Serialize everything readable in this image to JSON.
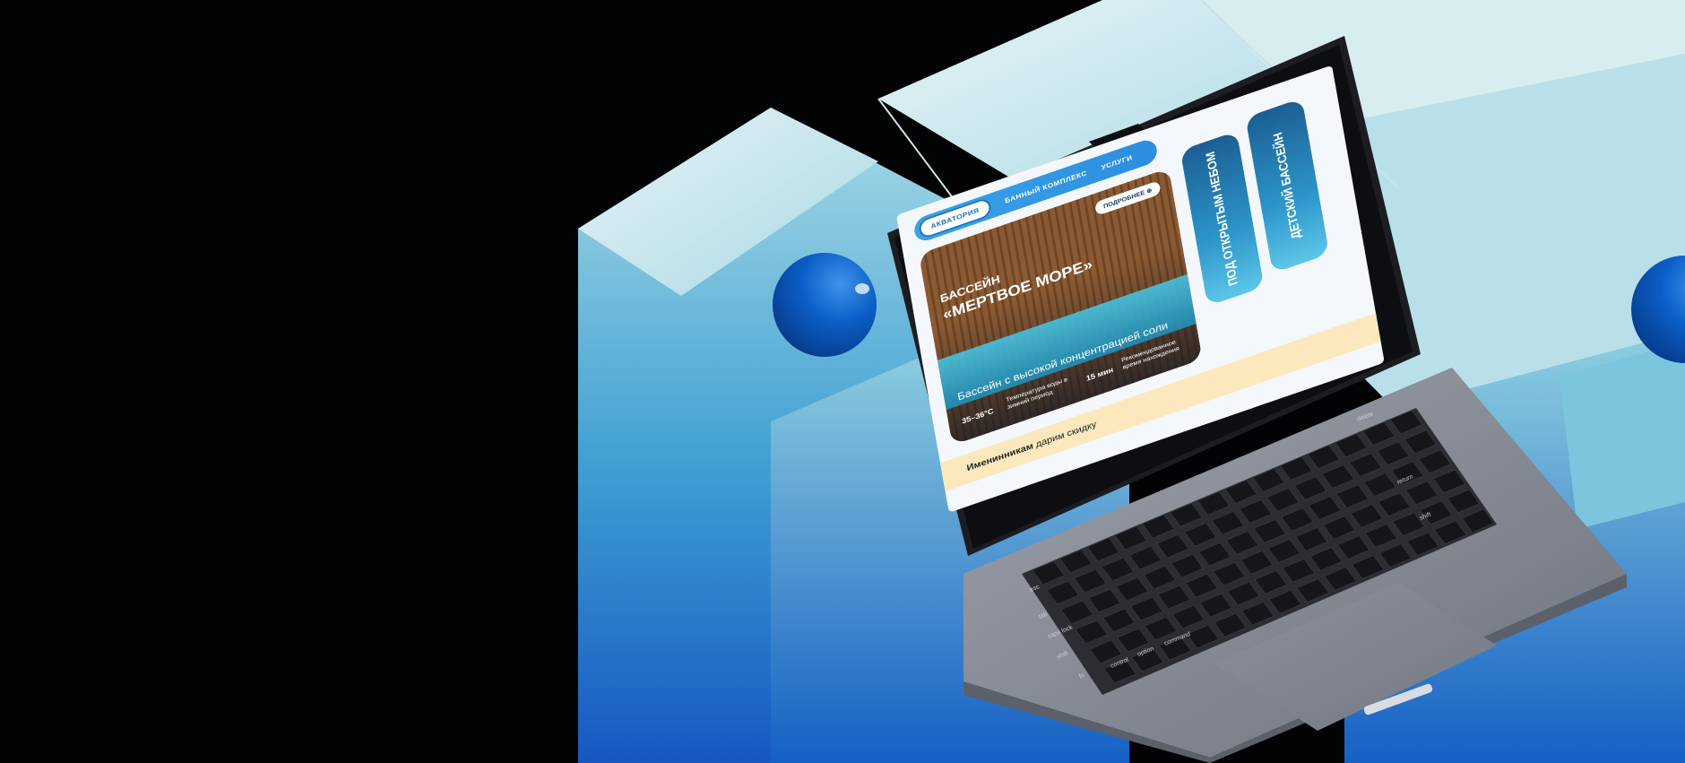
{
  "site": {
    "nav": {
      "items": [
        {
          "label": "АКВАТОРИЯ",
          "active": true
        },
        {
          "label": "БАННЫЙ КОМПЛЕКС",
          "active": false
        },
        {
          "label": "УСЛУГИ",
          "active": false
        }
      ]
    },
    "hero": {
      "more_label": "ПОДРОБНЕЕ",
      "kicker": "БАССЕЙН",
      "title": "«МЕРТВОЕ МОРЕ»",
      "subtitle": "Бассейн с высокой концентрацией соли",
      "stats": [
        {
          "value": "35–36°С",
          "label": "Температура воды в зимний период"
        },
        {
          "value": "15 мин",
          "label": "Рекомендованное время нахождения"
        }
      ]
    },
    "side_cards": [
      {
        "label": "ПОД ОТКРЫТЫМ НЕБОМ"
      },
      {
        "label": "ДЕТСКИЙ БАССЕЙН"
      }
    ],
    "promo": {
      "bold": "Именинникам",
      "rest": " дарим скидку"
    }
  },
  "keyboard": {
    "keys": [
      "esc",
      "tab",
      "caps lock",
      "shift",
      "fn",
      "control",
      "option",
      "command",
      "delete",
      "return",
      "shift"
    ]
  },
  "colors": {
    "background": "#020305",
    "block_light": "#cfe9ee",
    "block_mid": "#5fb3d6",
    "block_dark": "#1a62c8",
    "sphere": "#0d63c9",
    "laptop_body": "#8b8f99",
    "screen_accent": "#2b8ee0"
  }
}
